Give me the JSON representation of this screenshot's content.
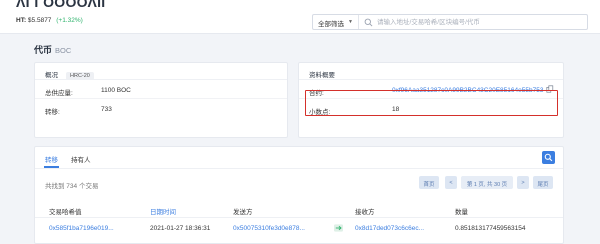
{
  "header": {
    "logo": "ΛΓΓΟΟΟΟΛΙΙ",
    "ht_label": "HT:",
    "ht_price": "$5.5877",
    "ht_change": "(+1.32%)",
    "filter_label": "全部筛选",
    "search_placeholder": "请输入地址/交易哈希/区块编号/代币"
  },
  "page": {
    "title": "代币",
    "symbol": "BOC"
  },
  "overview": {
    "title": "概况",
    "badge": "HRC-20",
    "rows": [
      {
        "label": "总供应量:",
        "value": "1100 BOC"
      },
      {
        "label": "转移:",
        "value": "733"
      }
    ]
  },
  "profile": {
    "title": "资料概要",
    "rows": [
      {
        "label": "合约:",
        "value": "0xf96Aaa351287c0A99B2BC43C20E85164e55b753"
      },
      {
        "label": "小数点:",
        "value": "18"
      }
    ]
  },
  "transfers": {
    "tabs": [
      "转移",
      "持有人"
    ],
    "summary": "共找到 734 个交易",
    "pager": {
      "first": "首页",
      "prev": "<",
      "info": "第 1 页, 共 30 页",
      "next": ">",
      "last": "尾页"
    },
    "columns": [
      "交易哈希值",
      "日期时间",
      "发送方",
      "接收方",
      "数量"
    ],
    "rows": [
      {
        "hash": "0x585f1ba7196e019...",
        "datetime": "2021-01-27 18:36:31",
        "from": "0x50075310fe3d0e878...",
        "to": "0x8d17ded073c6c6ec...",
        "amount": "0.851813177459563154"
      }
    ]
  },
  "colors": {
    "accent": "#3b7ee0",
    "positive": "#2fb36d",
    "highlight_border": "#d4302b"
  }
}
